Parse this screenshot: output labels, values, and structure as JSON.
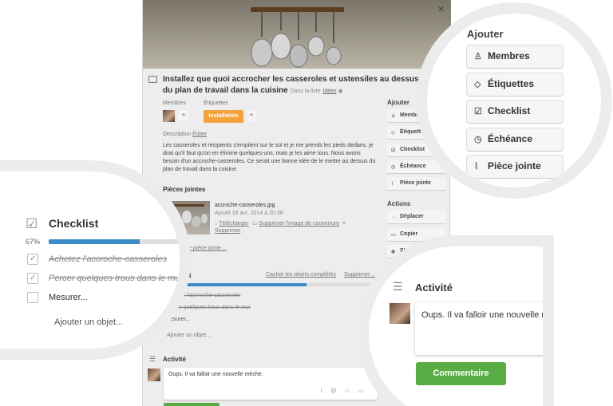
{
  "modal": {
    "close_glyph": "×",
    "card_title": "Installez que quoi accrocher les casseroles et ustensiles au dessus du plan de travail dans la cuisine",
    "list_prefix": "Dans la liste",
    "list_name": "Idées",
    "members_label": "Membres",
    "labels_label": "Étiquettes",
    "label_name": "Installation",
    "label_color": "#f2a33a",
    "plus": "+",
    "description_label": "Description",
    "edit_link": "Éditer",
    "description_text": "Les casseroles et récipients s'empilent sur le sol et je me prends les pieds dedans. je dirai qu'il faut qu'on en élimine quelques-uns, mais je les aime tous. Nous avons besoin d'un accroche-casseroles. Ce serait une bonne idée de le mettre au dessus du plan de travail dans la cuisine.",
    "attachments_title": "Pièces jointes",
    "attachment": {
      "filename": "accroche-casseroles.jpg",
      "added": "Ajouté 16 avr. 2014 à 20:38",
      "download": "Télécharger",
      "remove_cover": "Supprimer l'image de couverture",
      "delete": "Supprimer",
      "x": "×"
    },
    "add_attachment": "Ajouter une pièce jointe…",
    "checklist_title": "Checklist",
    "hide_completed": "Cacher les objets complétés",
    "delete_checklist": "Supprimer…",
    "checklist_items": [
      "Achetez l'accroche-casseroles",
      "Percer quelques trous dans le mur",
      "Mesurer..."
    ],
    "add_item": "Ajouter un objet…",
    "activity_title": "Activité",
    "comment_text": "Oups. Il va falloir une nouvelle mèche.",
    "sidebar": {
      "add_title": "Ajouter",
      "add_buttons": [
        "Membres",
        "Étiquettes",
        "Checklist",
        "Échéance",
        "Pièce jointe"
      ],
      "actions_title": "Actions",
      "action_buttons": [
        "Déplacer",
        "Copier",
        "S'abonner"
      ]
    }
  },
  "zoom_checklist": {
    "title": "Checklist",
    "percent": "67%",
    "progress": 0.67,
    "items": [
      "Achetez l'accroche-casseroles",
      "Percer quelques trous dans le mur",
      "Mesurer..."
    ],
    "add_item": "Ajouter un objet..."
  },
  "zoom_add": {
    "title": "Ajouter",
    "buttons": [
      "Membres",
      "Étiquettes",
      "Checklist",
      "Échéance",
      "Pièce jointe"
    ]
  },
  "zoom_activity": {
    "title": "Activité",
    "comment_text": "Oups. Il va falloir une nouvelle mèche.",
    "submit": "Commentaire",
    "submit_color": "#5aac44"
  }
}
